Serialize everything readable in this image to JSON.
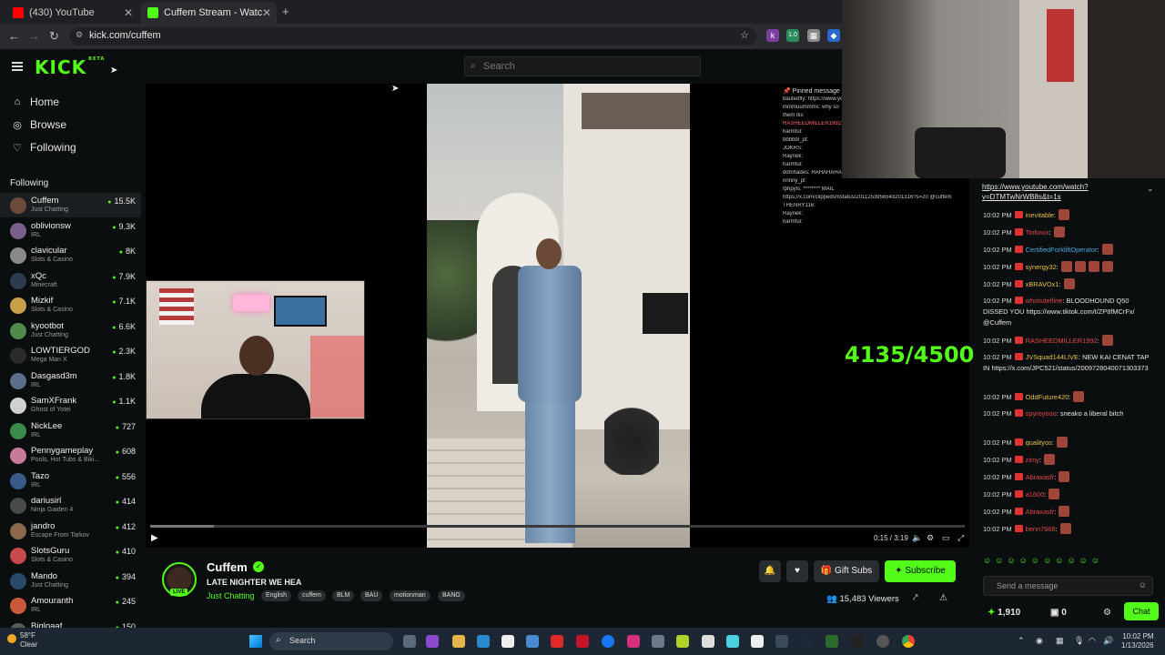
{
  "browser": {
    "tabs": [
      {
        "label": "(430) YouTube",
        "active": false
      },
      {
        "label": "Cuffem Stream - Watch Live",
        "active": true
      }
    ],
    "url": "kick.com/cuffem"
  },
  "header": {
    "logo": "KICK",
    "logo_badge": "BETA",
    "search_placeholder": "Search"
  },
  "sidebar": {
    "nav": [
      {
        "label": "Home",
        "icon": "home-icon"
      },
      {
        "label": "Browse",
        "icon": "compass-icon"
      },
      {
        "label": "Following",
        "icon": "heart-icon"
      }
    ],
    "following_label": "Following",
    "channels": [
      {
        "name": "Cuffem",
        "category": "Just Chatting",
        "viewers": "15.5K",
        "color": "#6b4a3a"
      },
      {
        "name": "oblivionsw",
        "category": "IRL",
        "viewers": "9.3K",
        "color": "#7a5f8a"
      },
      {
        "name": "clavicular",
        "category": "Slots & Casino",
        "viewers": "8K",
        "color": "#8a8a8a"
      },
      {
        "name": "xQc",
        "category": "Minecraft",
        "viewers": "7.9K",
        "color": "#2e3b4f"
      },
      {
        "name": "Mizkif",
        "category": "Slots & Casino",
        "viewers": "7.1K",
        "color": "#c8a04a"
      },
      {
        "name": "kyootbot",
        "category": "Just Chatting",
        "viewers": "6.6K",
        "color": "#4f8a4a"
      },
      {
        "name": "LOWTIERGOD",
        "category": "Mega Man X",
        "viewers": "2.3K",
        "color": "#2a2a2a"
      },
      {
        "name": "Dasgasd3m",
        "category": "IRL",
        "viewers": "1.8K",
        "color": "#5a6f8a"
      },
      {
        "name": "SamXFrank",
        "category": "Ghost of Yotei",
        "viewers": "1.1K",
        "color": "#d0d0d0"
      },
      {
        "name": "NickLee",
        "category": "IRL",
        "viewers": "727",
        "color": "#3a8a4a"
      },
      {
        "name": "Pennygameplay",
        "category": "Pools, Hot Tubs & Biki...",
        "viewers": "608",
        "color": "#c87a9a"
      },
      {
        "name": "Tazo",
        "category": "IRL",
        "viewers": "556",
        "color": "#3a5a8a"
      },
      {
        "name": "dariusirl",
        "category": "Ninja Gaiden 4",
        "viewers": "414",
        "color": "#4a4a4a"
      },
      {
        "name": "jandro",
        "category": "Escape From Tarkov",
        "viewers": "412",
        "color": "#8a6a4a"
      },
      {
        "name": "SlotsGuru",
        "category": "Slots & Casino",
        "viewers": "410",
        "color": "#c84a4a"
      },
      {
        "name": "Mando",
        "category": "Just Chatting",
        "viewers": "394",
        "color": "#2a4a6a"
      },
      {
        "name": "Amouranth",
        "category": "IRL",
        "viewers": "245",
        "color": "#c85a3a"
      },
      {
        "name": "Bigloaaf",
        "category": "",
        "viewers": "150",
        "color": "#5a5a5a"
      }
    ]
  },
  "player": {
    "pinned_title": "Pinned message",
    "pinned_lines": [
      {
        "user": "",
        "text": "bautedfly: https://www.youtube.com"
      },
      {
        "user": "",
        "text": "mmmuummms: why so"
      },
      {
        "user": "",
        "text": "them tks"
      },
      {
        "user": "RASHEEDMILLER1992:",
        "text": ""
      },
      {
        "user": "",
        "text": "harmful:"
      },
      {
        "user": "",
        "text": "bbbbbl_pt:"
      },
      {
        "user": "",
        "text": "JOKRS:"
      },
      {
        "user": "",
        "text": "Raynek:"
      },
      {
        "user": "",
        "text": "harmful:"
      },
      {
        "user": "",
        "text": "ddmhades: HAHAHAHA"
      },
      {
        "user": "",
        "text": "rinnny_pl:"
      },
      {
        "user": "",
        "text": "fphpyls: ******** MAIL"
      },
      {
        "user": "",
        "text": "https://x.com/clippedsmstatus/2011253956543201316?s=20 @cuffem"
      },
      {
        "user": "",
        "text": "THENRY116:"
      },
      {
        "user": "",
        "text": "Raynek:"
      },
      {
        "user": "",
        "text": "harmful:"
      }
    ],
    "goal_text": "4135/4500",
    "progress": 0.078,
    "time": "0:15 / 3:19"
  },
  "stream": {
    "name": "Cuffem",
    "title": "LATE NIGHTER WE HEA",
    "category": "Just Chatting",
    "live_label": "LIVE",
    "tags": [
      "English",
      "cuffem",
      "BLM",
      "BAU",
      "motionman",
      "BANG"
    ],
    "gift_subs_label": "Gift Subs",
    "subscribe_label": "Subscribe",
    "viewer_count": "15,483",
    "viewers_label": "Viewers"
  },
  "chat": {
    "pinned_link": "https://www.youtube.com/watch?v=DTMTwNrWB8s&t=1s",
    "messages": [
      {
        "time": "10:02 PM",
        "user": "inevitable",
        "color": "#e6c04a",
        "text": "",
        "emotes": 1
      },
      {
        "time": "10:02 PM",
        "user": "Torknox",
        "color": "#e04a4a",
        "text": "",
        "emotes": 1
      },
      {
        "time": "10:02 PM",
        "user": "CertifiedForkliftOperator",
        "color": "#4aa8e0",
        "text": "",
        "emotes": 1
      },
      {
        "time": "10:02 PM",
        "user": "synergy32",
        "color": "#e6c04a",
        "text": "",
        "emotes": 4
      },
      {
        "time": "10:02 PM",
        "user": "xBRAVOx1",
        "color": "#e6c04a",
        "text": "",
        "emotes": 1
      },
      {
        "time": "10:02 PM",
        "user": "wholsdelfine",
        "color": "#e04a4a",
        "text": "BLOODHOUND Q50 DISSED YOU https://www.tiktok.com/t/ZP8fMCrFx/ @Cuffem",
        "emotes": 0
      },
      {
        "time": "10:02 PM",
        "user": "RASHEEDMILLER1992",
        "color": "#e04a4a",
        "text": "",
        "emotes": 1
      },
      {
        "time": "10:02 PM",
        "user": "JVSquad144LIVE",
        "color": "#e6c04a",
        "text": "NEW KAI CENAT TAP IN https://x.com/JPC521/status/2009728040071303373",
        "emotes": 0
      },
      {
        "time": "10:02 PM",
        "user": "OddFuture420",
        "color": "#e6c04a",
        "text": "",
        "emotes": 1
      },
      {
        "time": "10:02 PM",
        "user": "spyroyooo",
        "color": "#e04a4a",
        "text": "sneako a liberal bitch",
        "emotes": 0
      },
      {
        "time": "10:02 PM",
        "user": "qualityos",
        "color": "#e6c04a",
        "text": "",
        "emotes": 1
      },
      {
        "time": "10:02 PM",
        "user": "zimy",
        "color": "#e04a4a",
        "text": "",
        "emotes": 1
      },
      {
        "time": "10:02 PM",
        "user": "Abraxasfr",
        "color": "#e04a4a",
        "text": "",
        "emotes": 1
      },
      {
        "time": "10:02 PM",
        "user": "a1600",
        "color": "#e04a4a",
        "text": "",
        "emotes": 1
      },
      {
        "time": "10:02 PM",
        "user": "Abraxasfr",
        "color": "#e04a4a",
        "text": "",
        "emotes": 1
      },
      {
        "time": "10:02 PM",
        "user": "benn7668",
        "color": "#e04a4a",
        "text": "",
        "emotes": 1
      }
    ],
    "input_placeholder": "Send a message",
    "points": "1,910",
    "slots": "0",
    "chat_button": "Chat"
  },
  "taskbar": {
    "weather_temp": "58°F",
    "weather_desc": "Clear",
    "search_label": "Search",
    "time": "10:02 PM",
    "date": "1/13/2026"
  }
}
